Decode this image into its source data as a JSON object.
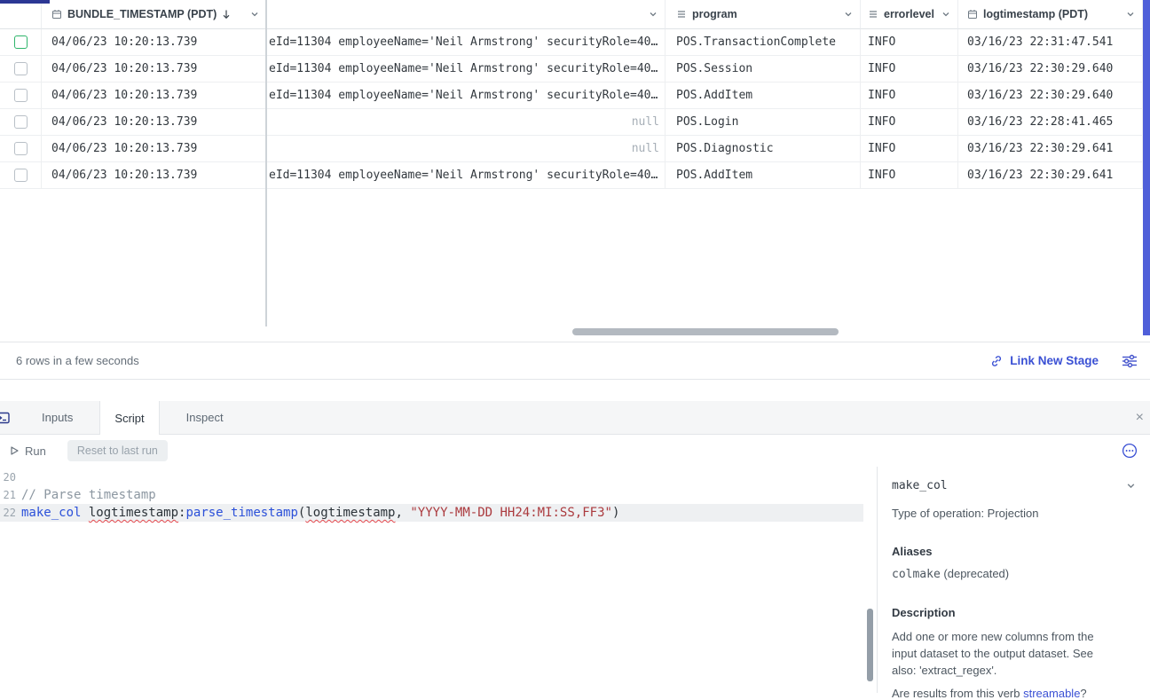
{
  "accent": "#3a50d4",
  "table": {
    "header": {
      "bundle": {
        "label": "BUNDLE_TIMESTAMP (PDT)",
        "sort": "desc"
      },
      "message": {
        "label": ""
      },
      "program": {
        "label": "program"
      },
      "errorlevel": {
        "label": "errorlevel"
      },
      "logtimestamp": {
        "label": "logtimestamp (PDT)"
      }
    },
    "rows": [
      {
        "bundle_timestamp": "04/06/23 10:20:13.739",
        "message": "eId=11304 employeeName='Neil Armstrong' securityRole=40…",
        "message_is_null": false,
        "program": "POS.TransactionComplete",
        "errorlevel": "INFO",
        "logtimestamp": "03/16/23 22:31:47.541",
        "checkbox_highlight": true
      },
      {
        "bundle_timestamp": "04/06/23 10:20:13.739",
        "message": "eId=11304 employeeName='Neil Armstrong' securityRole=40…",
        "message_is_null": false,
        "program": "POS.Session",
        "errorlevel": "INFO",
        "logtimestamp": "03/16/23 22:30:29.640",
        "checkbox_highlight": false
      },
      {
        "bundle_timestamp": "04/06/23 10:20:13.739",
        "message": "eId=11304 employeeName='Neil Armstrong' securityRole=40…",
        "message_is_null": false,
        "program": "POS.AddItem",
        "errorlevel": "INFO",
        "logtimestamp": "03/16/23 22:30:29.640",
        "checkbox_highlight": false
      },
      {
        "bundle_timestamp": "04/06/23 10:20:13.739",
        "message": "null",
        "message_is_null": true,
        "program": "POS.Login",
        "errorlevel": "INFO",
        "logtimestamp": "03/16/23 22:28:41.465",
        "checkbox_highlight": false
      },
      {
        "bundle_timestamp": "04/06/23 10:20:13.739",
        "message": "null",
        "message_is_null": true,
        "program": "POS.Diagnostic",
        "errorlevel": "INFO",
        "logtimestamp": "03/16/23 22:30:29.641",
        "checkbox_highlight": false
      },
      {
        "bundle_timestamp": "04/06/23 10:20:13.739",
        "message": "eId=11304 employeeName='Neil Armstrong' securityRole=40…",
        "message_is_null": false,
        "program": "POS.AddItem",
        "errorlevel": "INFO",
        "logtimestamp": "03/16/23 22:30:29.641",
        "checkbox_highlight": false
      }
    ]
  },
  "statusbar": {
    "summary": "6 rows in a few seconds",
    "link_new_stage": "Link New Stage"
  },
  "panel": {
    "tabs": [
      {
        "label": "Inputs",
        "active": false
      },
      {
        "label": "Script",
        "active": true
      },
      {
        "label": "Inspect",
        "active": false
      }
    ],
    "toolbar": {
      "run": "Run",
      "reset": "Reset to last run"
    },
    "editor": {
      "lines": [
        {
          "number": "20",
          "active": false,
          "tokens": []
        },
        {
          "number": "21",
          "active": false,
          "tokens": [
            {
              "t": "// Parse timestamp",
              "c": "comment"
            }
          ]
        },
        {
          "number": "22",
          "active": true,
          "tokens": [
            {
              "t": "make_col",
              "c": "keyword"
            },
            {
              "t": " ",
              "c": "plain"
            },
            {
              "t": "logtimestamp",
              "c": "plain",
              "squiggle": true
            },
            {
              "t": ":",
              "c": "plain"
            },
            {
              "t": "parse_timestamp",
              "c": "func"
            },
            {
              "t": "(",
              "c": "plain"
            },
            {
              "t": "logtimestamp",
              "c": "plain",
              "squiggle": true
            },
            {
              "t": ", ",
              "c": "plain"
            },
            {
              "t": "\"YYYY-MM-DD HH24:MI:SS,FF3\"",
              "c": "string"
            },
            {
              "t": ")",
              "c": "plain"
            }
          ]
        }
      ]
    },
    "docs": {
      "title": "make_col",
      "type_line": "Type of operation: Projection",
      "aliases_heading": "Aliases",
      "alias_code": "colmake",
      "alias_note": " (deprecated)",
      "description_heading": "Description",
      "description": "Add one or more new columns from the input dataset to the output dataset. See also: 'extract_regex'.",
      "footer_prefix": "Are results from this verb ",
      "footer_link": "streamable",
      "footer_suffix": "?"
    }
  }
}
